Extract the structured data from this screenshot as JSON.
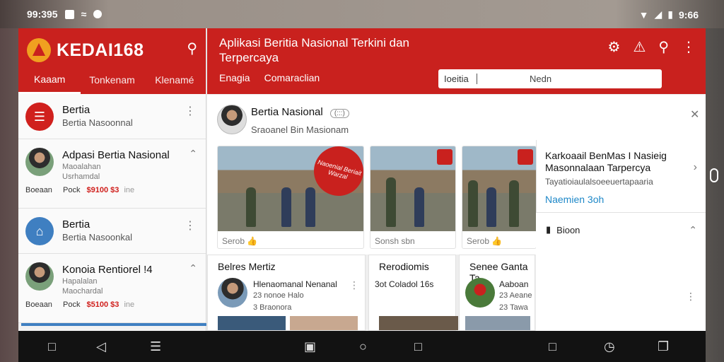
{
  "status": {
    "time": "99:395",
    "right_time": "9:66"
  },
  "app": {
    "brand": "KEDAI168"
  },
  "sidebar": {
    "tabs": [
      "Kaaam",
      "Tonkenam",
      "Klenamé"
    ],
    "items": [
      {
        "title": "Bertia",
        "subtitle": "Bertia Nasoonnal",
        "type": "logo"
      },
      {
        "title": "Adpasi Bertia Nasional",
        "line1": "Maoalahan",
        "line2": "Usrhamdal",
        "meta_label": "Boeaan",
        "meta_prefix": "Pock",
        "price": "$9100 $3",
        "unit": "ine"
      },
      {
        "title": "Bertia",
        "subtitle": "Bertia Nasoonkal",
        "type": "home"
      },
      {
        "title": "Konoia Rentiorel !4",
        "line1": "Hapalalan",
        "line2": "Maochardal",
        "meta_label": "Boeaan",
        "meta_prefix": "Pock",
        "price": "$5100 $3",
        "unit": "ine"
      }
    ]
  },
  "header": {
    "title": "Aplikasi Beritia Nasional Terkini dan Terpercaya",
    "tabs": [
      "Enagia",
      "Comaraclian"
    ],
    "search_query": "Ioeitia",
    "search_placeholder": "Nedn"
  },
  "featured": {
    "title": "Bertia Nasional",
    "badge": "(:::)",
    "subtitle": "Sraoanel Bin Masionam",
    "thumbs": [
      {
        "caption": "Serob",
        "stamp": "Naoenial Beriait Warzal"
      },
      {
        "caption": "Sonsh sbn"
      },
      {
        "caption": "Serob"
      }
    ]
  },
  "promo": {
    "title": "Karkoaail BenMas I Nasieig Masonnalaan Tarpercya",
    "subtitle": "Tayatioiaulalsoeeuertapaaria",
    "link": "Naemien 3oh"
  },
  "side_panel": {
    "title": "Bioon"
  },
  "cards": [
    {
      "title": "Belres Mertiz",
      "line1": "Hlenaomanal Nenanal",
      "line2": "23 nonoe Halo",
      "line3": "3 Braonora"
    },
    {
      "title": "Rerodiomis",
      "line1": "3ot Coladol 16s"
    },
    {
      "title": "Senee Ganta Ta",
      "line1": "Aaboan",
      "line2": "23 Aeane",
      "line3": "23 Tawa"
    }
  ],
  "colors": {
    "brand_red": "#c9211e",
    "link_blue": "#1e88c8"
  }
}
